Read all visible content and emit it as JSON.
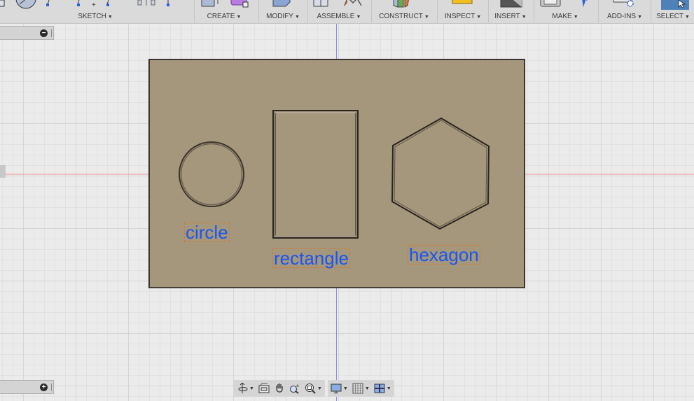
{
  "toolbar": {
    "groups": [
      {
        "label": "SKETCH",
        "icon": "sketch-tools-icons"
      },
      {
        "label": "CREATE",
        "icon": "create-box-icon"
      },
      {
        "label": "MODIFY",
        "icon": "modify-press-pull-icon"
      },
      {
        "label": "ASSEMBLE",
        "icon": "assemble-joint-icon"
      },
      {
        "label": "CONSTRUCT",
        "icon": "construct-plane-icon"
      },
      {
        "label": "INSPECT",
        "icon": "inspect-measure-icon"
      },
      {
        "label": "INSERT",
        "icon": "insert-image-icon"
      },
      {
        "label": "MAKE",
        "icon": "make-3d-print-icon"
      },
      {
        "label": "ADD-INS",
        "icon": "add-ins-gear-icon"
      },
      {
        "label": "SELECT",
        "icon": "select-cursor-icon"
      }
    ],
    "dropdown_glyph": "▼"
  },
  "panels": {
    "top_button": "−",
    "bottom_button": "+"
  },
  "model": {
    "plate_color": "#a5977c",
    "labels": {
      "circle": "circle",
      "rectangle": "rectangle",
      "hexagon": "hexagon"
    },
    "label_color": "#1a55f0"
  },
  "navbar": {
    "tools": [
      "orbit",
      "look-at",
      "pan",
      "zoom",
      "fit",
      "display-settings",
      "grid-settings",
      "viewports"
    ]
  }
}
